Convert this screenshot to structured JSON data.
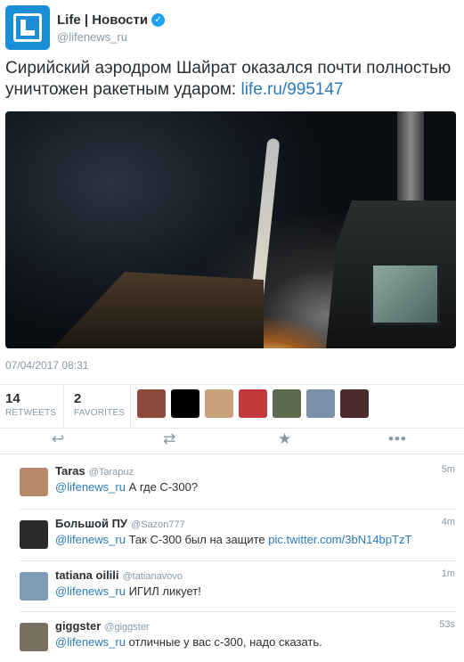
{
  "account": {
    "display_name": "Life | Новости",
    "handle": "@lifenews_ru",
    "verified_icon": "check-icon"
  },
  "tweet": {
    "text": "Сирийский аэродром Шайрат оказался почти полностью уничтожен ракетным ударом: ",
    "link": "life.ru/995147",
    "timestamp": "07/04/2017 08:31"
  },
  "stats": {
    "retweets_count": "14",
    "retweets_label": "RETWEETS",
    "favorites_count": "2",
    "favorites_label": "FAVORITES",
    "liker_colors": [
      "#8b4a3a",
      "#000000",
      "#c9a07c",
      "#c23a3a",
      "#5c6a50",
      "#7a8fa8",
      "#4a2c2c"
    ]
  },
  "actions": {
    "reply_icon": "reply-icon",
    "retweet_icon": "retweet-icon",
    "favorite_icon": "star-icon",
    "more_icon": "more-icon"
  },
  "replies": [
    {
      "name": "Taras",
      "handle": "@Tarapuz",
      "time": "5m",
      "mention": "@lifenews_ru",
      "text": " А где С-300?",
      "link": "",
      "avatar_color": "#b98a6a"
    },
    {
      "name": "Большой ПУ",
      "handle": "@Sazon777",
      "time": "4m",
      "mention": "@lifenews_ru",
      "text": " Так С-300 был на защите ",
      "link": "pic.twitter.com/3bN14bpTzT",
      "avatar_color": "#2a2a2a"
    },
    {
      "name": "tatiana oilili",
      "handle": "@tatianavovo",
      "time": "1m",
      "mention": "@lifenews_ru",
      "text": " ИГИЛ ликует!",
      "link": "",
      "avatar_color": "#7f9bb8"
    },
    {
      "name": "giggster",
      "handle": "@giggster",
      "time": "53s",
      "mention": "@lifenews_ru",
      "text": " отличные у вас с-300, надо сказать.",
      "link": "",
      "avatar_color": "#7a7060"
    }
  ]
}
